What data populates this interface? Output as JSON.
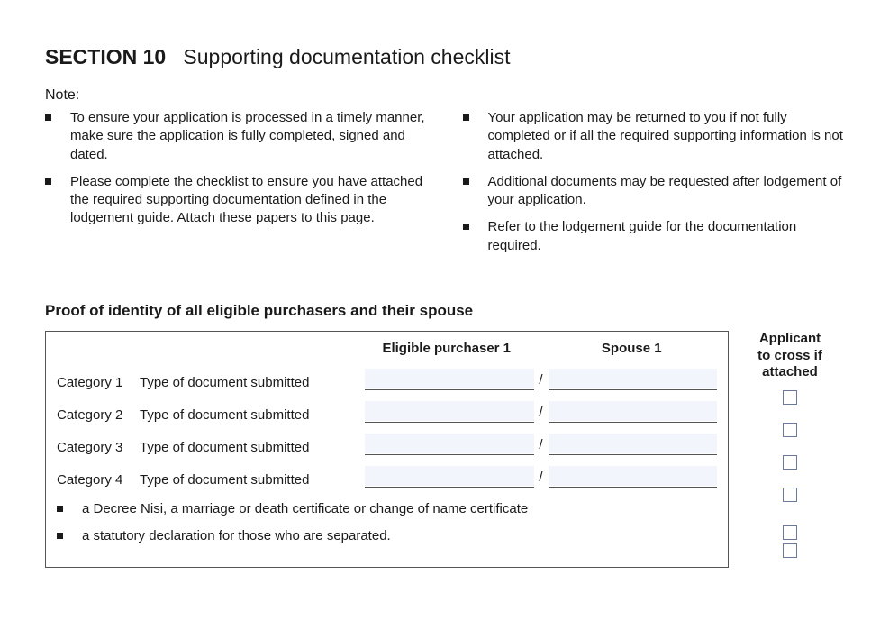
{
  "section": {
    "number": "SECTION 10",
    "title": "Supporting documentation checklist"
  },
  "note_label": "Note:",
  "notes_left": [
    "To ensure your application is processed in a timely manner, make sure the application is fully completed, signed and dated.",
    "Please complete the checklist to ensure you have attached the required supporting documentation defined in the lodgement guide. Attach these papers to this page."
  ],
  "notes_right": [
    "Your application may be returned to you if not fully completed or if all the required supporting information is not attached.",
    "Additional documents may be requested after lodgement of your application.",
    "Refer to the lodgement guide for the documentation required."
  ],
  "proof_heading": "Proof of identity of all eligible purchasers and their spouse",
  "table": {
    "col_ep": "Eligible purchaser 1",
    "col_sp": "Spouse 1",
    "side_label_l1": "Applicant",
    "side_label_l2": "to cross if",
    "side_label_l3": "attached",
    "type_label": "Type of document submitted",
    "slash": "/",
    "categories": [
      "Category 1",
      "Category 2",
      "Category 3",
      "Category 4"
    ],
    "extra": [
      "a Decree Nisi, a marriage or death certificate or change of name certificate",
      "a statutory declaration for those who are separated."
    ]
  }
}
